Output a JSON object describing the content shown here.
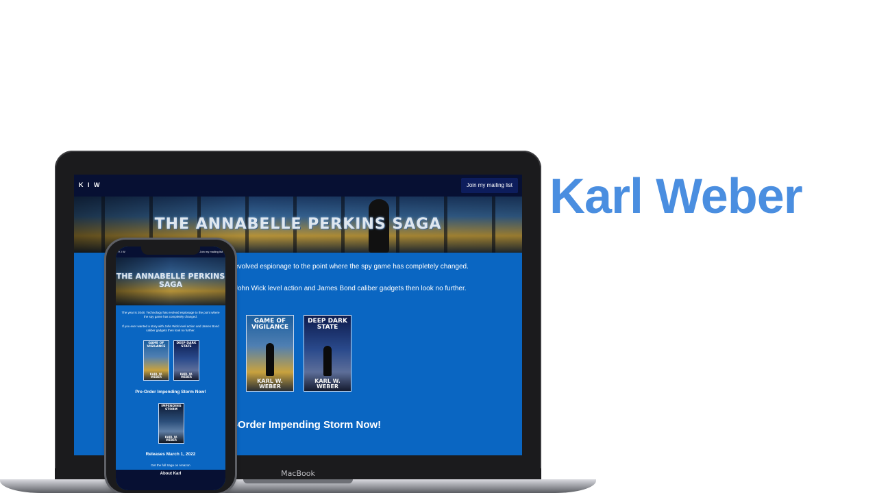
{
  "brand": {
    "name": "Karl Weber"
  },
  "laptop": {
    "model_label": "MacBook"
  },
  "site": {
    "nav": {
      "logo": "K I W",
      "mailing_button": "Join my mailing list"
    },
    "hero": {
      "title": "THE ANNABELLE PERKINS SAGA"
    },
    "intro_line_1": "evolved espionage to the point where the spy game has completely changed.",
    "intro_line_2": "John Wick level action and James Bond caliber gadgets then look no further.",
    "books": [
      {
        "title": "GAME OF VIGILANCE",
        "author": "KARL W. WEBER",
        "color": "#1b5e9e"
      },
      {
        "title": "DEEP DARK STATE",
        "author": "KARL W. WEBER",
        "color": "#14276b"
      }
    ],
    "preorder_heading": "-Order Impending Storm Now!"
  },
  "phone": {
    "nav": {
      "logo": "K I W",
      "mailing_button": "Join my mailing list"
    },
    "hero": {
      "title": "THE ANNABELLE PERKINS SAGA"
    },
    "intro_text_1": "The year is 2048. Technology has evolved espionage to the point where the spy game has completely changed.",
    "intro_text_2": "If you ever wanted a story with John Wick level action and James Bond caliber gadgets then look no further.",
    "books": [
      {
        "title": "GAME OF VIGILANCE",
        "author": "KARL W. WEBER"
      },
      {
        "title": "DEEP DARK STATE",
        "author": "KARL W. WEBER"
      }
    ],
    "preorder_heading": "Pre-Order Impending Storm Now!",
    "featured_book": {
      "title": "IMPENDING STORM",
      "author": "KARL W. WEBER"
    },
    "release_text": "Releases March 1, 2022",
    "amazon_link": "Get the full Saga on Amazon",
    "footer_heading": "About Karl"
  }
}
